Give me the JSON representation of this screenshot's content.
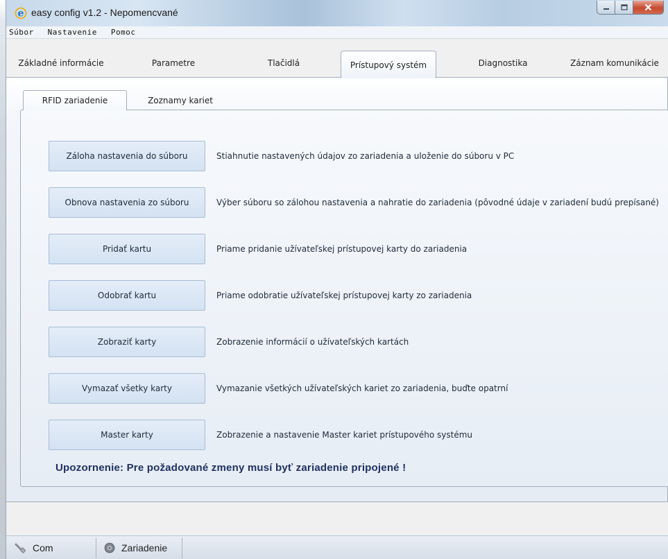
{
  "window": {
    "title": "easy config v1.2 - Nepomencvané",
    "app_icon": "ie-e-icon"
  },
  "menu": [
    "Súbor",
    "Nastavenie",
    "Pomoc"
  ],
  "main_tabs": [
    {
      "label": "Základné informácie",
      "active": false
    },
    {
      "label": "Parametre",
      "active": false
    },
    {
      "label": "Tlačidlá",
      "active": false
    },
    {
      "label": "Prístupový systém",
      "active": true
    },
    {
      "label": "Diagnostika",
      "active": false
    },
    {
      "label": "Záznam komunikácie",
      "active": false
    }
  ],
  "sub_tabs": [
    {
      "label": "RFID zariadenie",
      "active": true
    },
    {
      "label": "Zoznamy kariet",
      "active": false
    }
  ],
  "actions": [
    {
      "button": "Záloha nastavenia do súboru",
      "description": "Stiahnutie nastavených údajov zo zariadenia a uloženie do súboru v PC"
    },
    {
      "button": "Obnova nastavenia zo súboru",
      "description": "Výber súboru so zálohou nastavenia a nahratie do zariadenia (pôvodné údaje v zariadení budú prepísané)"
    },
    {
      "button": "Pridať kartu",
      "description": "Priame pridanie užívateľskej prístupovej karty do zariadenia"
    },
    {
      "button": "Odobrať kartu",
      "description": "Priame odobratie užívateľskej prístupovej karty zo zariadenia"
    },
    {
      "button": "Zobraziť karty",
      "description": "Zobrazenie informácií o užívateľských kartách"
    },
    {
      "button": "Vymazať všetky karty",
      "description": "Vymazanie všetkých užívateľských kariet zo zariadenia, buďte opatrní"
    },
    {
      "button": "Master karty",
      "description": "Zobrazenie a nastavenie Master kariet prístupového systému"
    }
  ],
  "warning": "Upozornenie: Pre požadované zmeny musí byť zariadenie pripojené !",
  "status": {
    "com_label": "Com",
    "device_label": "Zariadenie"
  },
  "colors": {
    "warning_text": "#1f2f5f",
    "close_button": "#c74a30",
    "button_fill": "#d4e2f2"
  }
}
